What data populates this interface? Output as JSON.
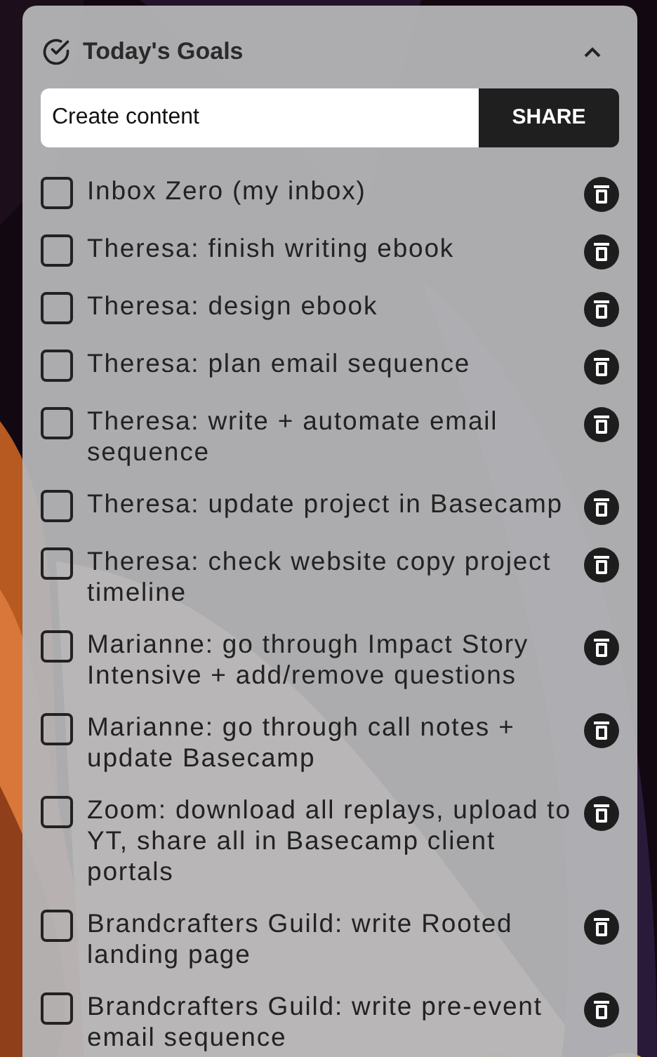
{
  "panel": {
    "title": "Today's Goals",
    "expanded": true
  },
  "new_goal": {
    "value": "Create content",
    "button": "SHARE"
  },
  "goals": [
    {
      "text": "Inbox Zero (my inbox)",
      "checked": false
    },
    {
      "text": "Theresa: finish writing ebook",
      "checked": false
    },
    {
      "text": "Theresa: design ebook",
      "checked": false
    },
    {
      "text": "Theresa: plan email sequence",
      "checked": false
    },
    {
      "text": "Theresa: write + automate email sequence",
      "checked": false
    },
    {
      "text": "Theresa: update project in Basecamp",
      "checked": false
    },
    {
      "text": "Theresa: check website copy project timeline",
      "checked": false
    },
    {
      "text": "Marianne: go through Impact Story Intensive + add/remove questions",
      "checked": false
    },
    {
      "text": "Marianne: go through call notes + update Basecamp",
      "checked": false
    },
    {
      "text": "Zoom: download all replays, upload to YT, share all in Basecamp client portals",
      "checked": false
    },
    {
      "text": "Brandcrafters Guild: write Rooted landing page",
      "checked": false
    },
    {
      "text": "Brandcrafters Guild: write pre-event email sequence",
      "checked": false
    }
  ]
}
